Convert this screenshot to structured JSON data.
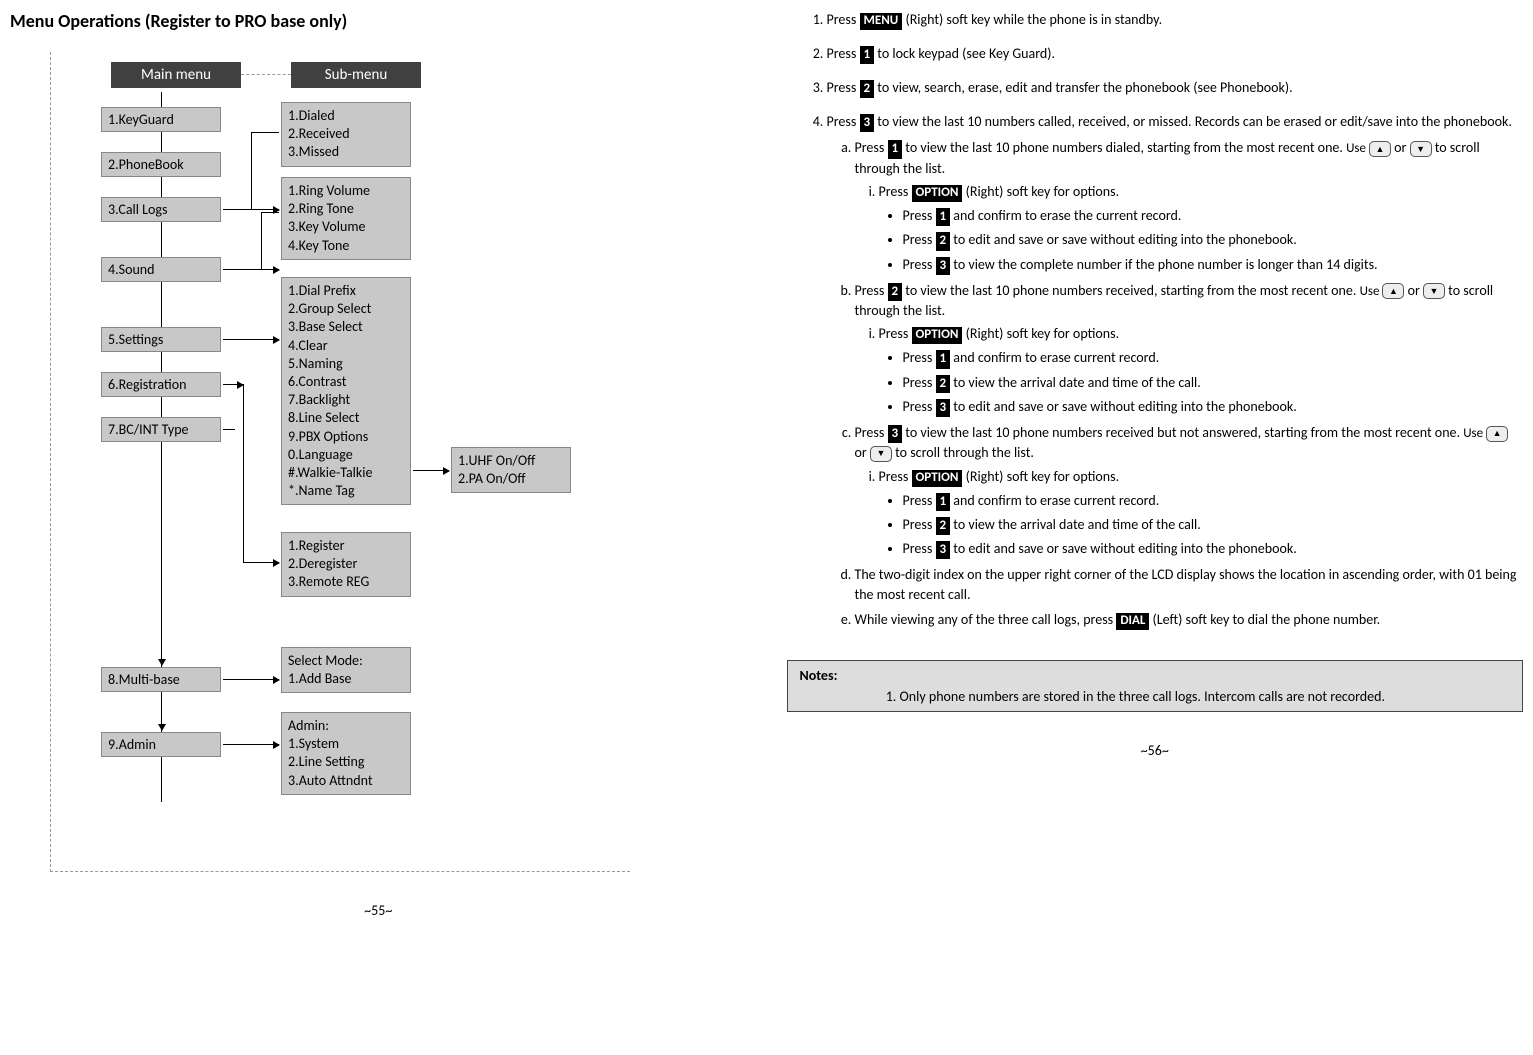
{
  "left_page": {
    "title": "Menu Operations (Register to PRO base only)",
    "main_menu_header": "Main menu",
    "sub_menu_header": "Sub-menu",
    "main_items": [
      "1.KeyGuard",
      "2.PhoneBook",
      "3.Call Logs",
      "4.Sound",
      "5.Settings",
      "6.Registration",
      "7.BC/INT Type",
      "8.Multi-base",
      "9.Admin"
    ],
    "sub_call_logs": [
      "1.Dialed",
      "2.Received",
      "3.Missed"
    ],
    "sub_sound": [
      "1.Ring Volume",
      "2.Ring Tone",
      "3.Key Volume",
      "4.Key Tone"
    ],
    "sub_settings": [
      "1.Dial Prefix",
      "2.Group Select",
      "3.Base Select",
      "4.Clear",
      "5.Naming",
      "6.Contrast",
      "7.Backlight",
      "8.Line Select",
      "9.PBX Options",
      "0.Language",
      "#.Walkie-Talkie",
      "*.Name Tag"
    ],
    "sub_registration": [
      "1.Register",
      "2.Deregister",
      "3.Remote REG"
    ],
    "sub_multibase_title": "Select Mode:",
    "sub_multibase": [
      "1.Add Base"
    ],
    "sub_admin_title": "Admin:",
    "sub_admin": [
      "1.System",
      "2.Line Setting",
      "3.Auto Attndnt"
    ],
    "third_walkie": [
      "1.UHF On/Off",
      "2.PA On/Off"
    ],
    "page_number": "~55~"
  },
  "right_page": {
    "step1_a": "Press ",
    "step1_key": "MENU",
    "step1_b": " (Right) soft key while the phone is in standby.",
    "step2_a": "Press ",
    "step2_key": "1",
    "step2_b": " to lock keypad (see Key Guard).",
    "step3_a": "Press ",
    "step3_key": "2",
    "step3_b": " to view, search, erase, edit and transfer the phonebook (see Phonebook).",
    "step4_a": "Press ",
    "step4_key": "3",
    "step4_b": " to view the last 10 numbers called, received, or missed.  Records can be erased or edit/save into the phonebook.",
    "s4a_a": "Press ",
    "s4a_key": "1",
    "s4a_b": " to view the last 10 phone numbers dialed, starting from the most recent one.  ",
    "use_label": "Use ",
    "or_label": " or ",
    "scroll_tail": "  to scroll through the list.",
    "opt_a": "Press ",
    "opt_key": "OPTION",
    "opt_b": " (Right) soft key for options.",
    "s4a_bul1_a": "Press ",
    "s4a_bul1_key": "1",
    "s4a_bul1_b": " and confirm to erase the current record.",
    "s4a_bul2_a": "Press ",
    "s4a_bul2_key": "2",
    "s4a_bul2_b": " to edit and save or save without editing into the phonebook.",
    "s4a_bul3_a": "Press ",
    "s4a_bul3_key": "3",
    "s4a_bul3_b": " to view the complete number if the phone number is longer than 14 digits.",
    "s4b_a": "Press ",
    "s4b_key": "2",
    "s4b_b": " to view the last 10 phone numbers received, starting from the most recent one.  ",
    "scroll_tail2": " to scroll through the list.",
    "s4b_bul1_b": " and confirm to erase current record.",
    "s4b_bul2_a": "Press ",
    "s4b_bul2_key": "2",
    "s4b_bul2_b": " to view the arrival date and time of the call.",
    "s4b_bul3_a": "Press ",
    "s4b_bul3_key": "3",
    "s4b_bul3_b": " to edit and save or save without editing into the phonebook.",
    "s4c_a": "Press ",
    "s4c_key": "3",
    "s4c_b": " to view the last 10 phone numbers received but not answered, starting from the most recent one.  ",
    "scroll_tail3": " to scroll through the list.",
    "s4d": "The two-digit index on the upper right corner of the LCD display shows the location in ascending order, with 01 being the most recent call.",
    "s4e_a": "While viewing any of the three call logs, press ",
    "s4e_key": "DIAL",
    "s4e_b": " (Left) soft key to dial the phone number.",
    "notes_title": "Notes:",
    "notes_1": "Only phone numbers are stored in the three call logs.  Intercom calls are not recorded.",
    "page_number": "~56~"
  }
}
